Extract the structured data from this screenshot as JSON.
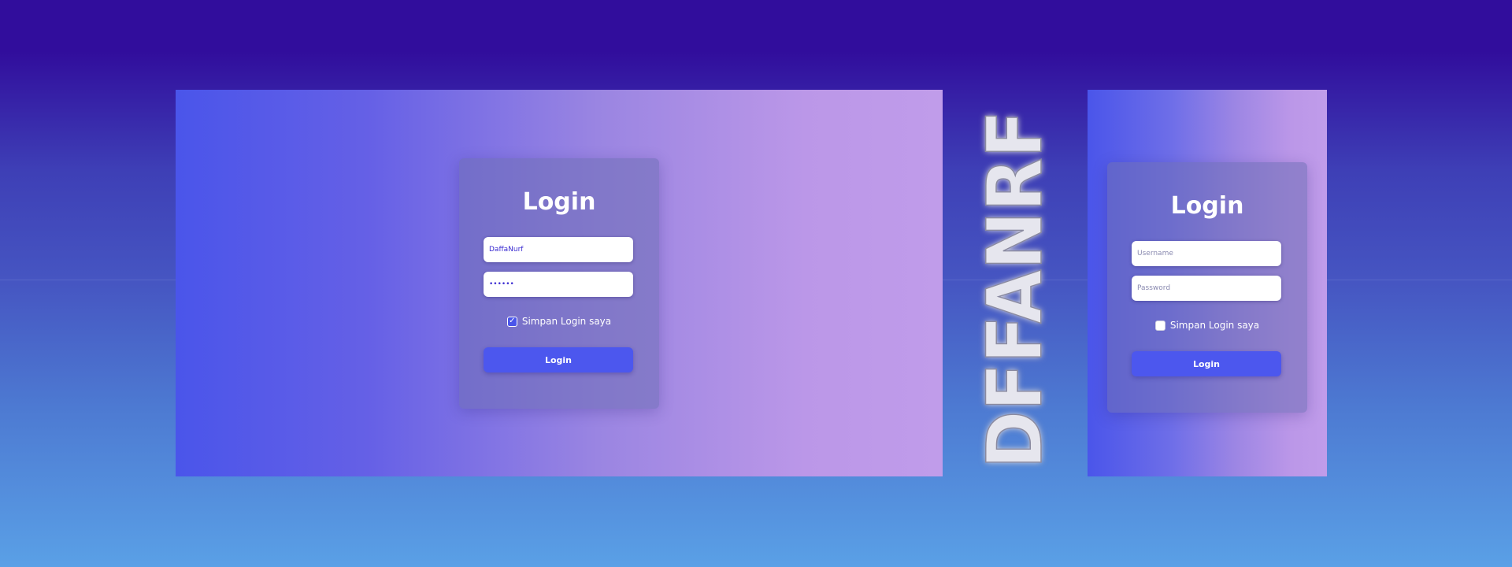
{
  "desktop": {
    "title": "Login",
    "username_value": "DaffaNurf",
    "username_placeholder": "Username",
    "password_value": "••••••",
    "password_placeholder": "Password",
    "remember_label": "Simpan Login saya",
    "remember_checked": true,
    "button_label": "Login"
  },
  "mobile": {
    "title": "Login",
    "username_value": "",
    "username_placeholder": "Username",
    "password_value": "",
    "password_placeholder": "Password",
    "remember_label": "Simpan Login saya",
    "remember_checked": false,
    "button_label": "Login"
  },
  "brand": {
    "logo_text": "DFFANRF"
  },
  "colors": {
    "accent": "#4c57ee",
    "gradient_start": "#4a55ea",
    "gradient_end": "#c09cea"
  }
}
